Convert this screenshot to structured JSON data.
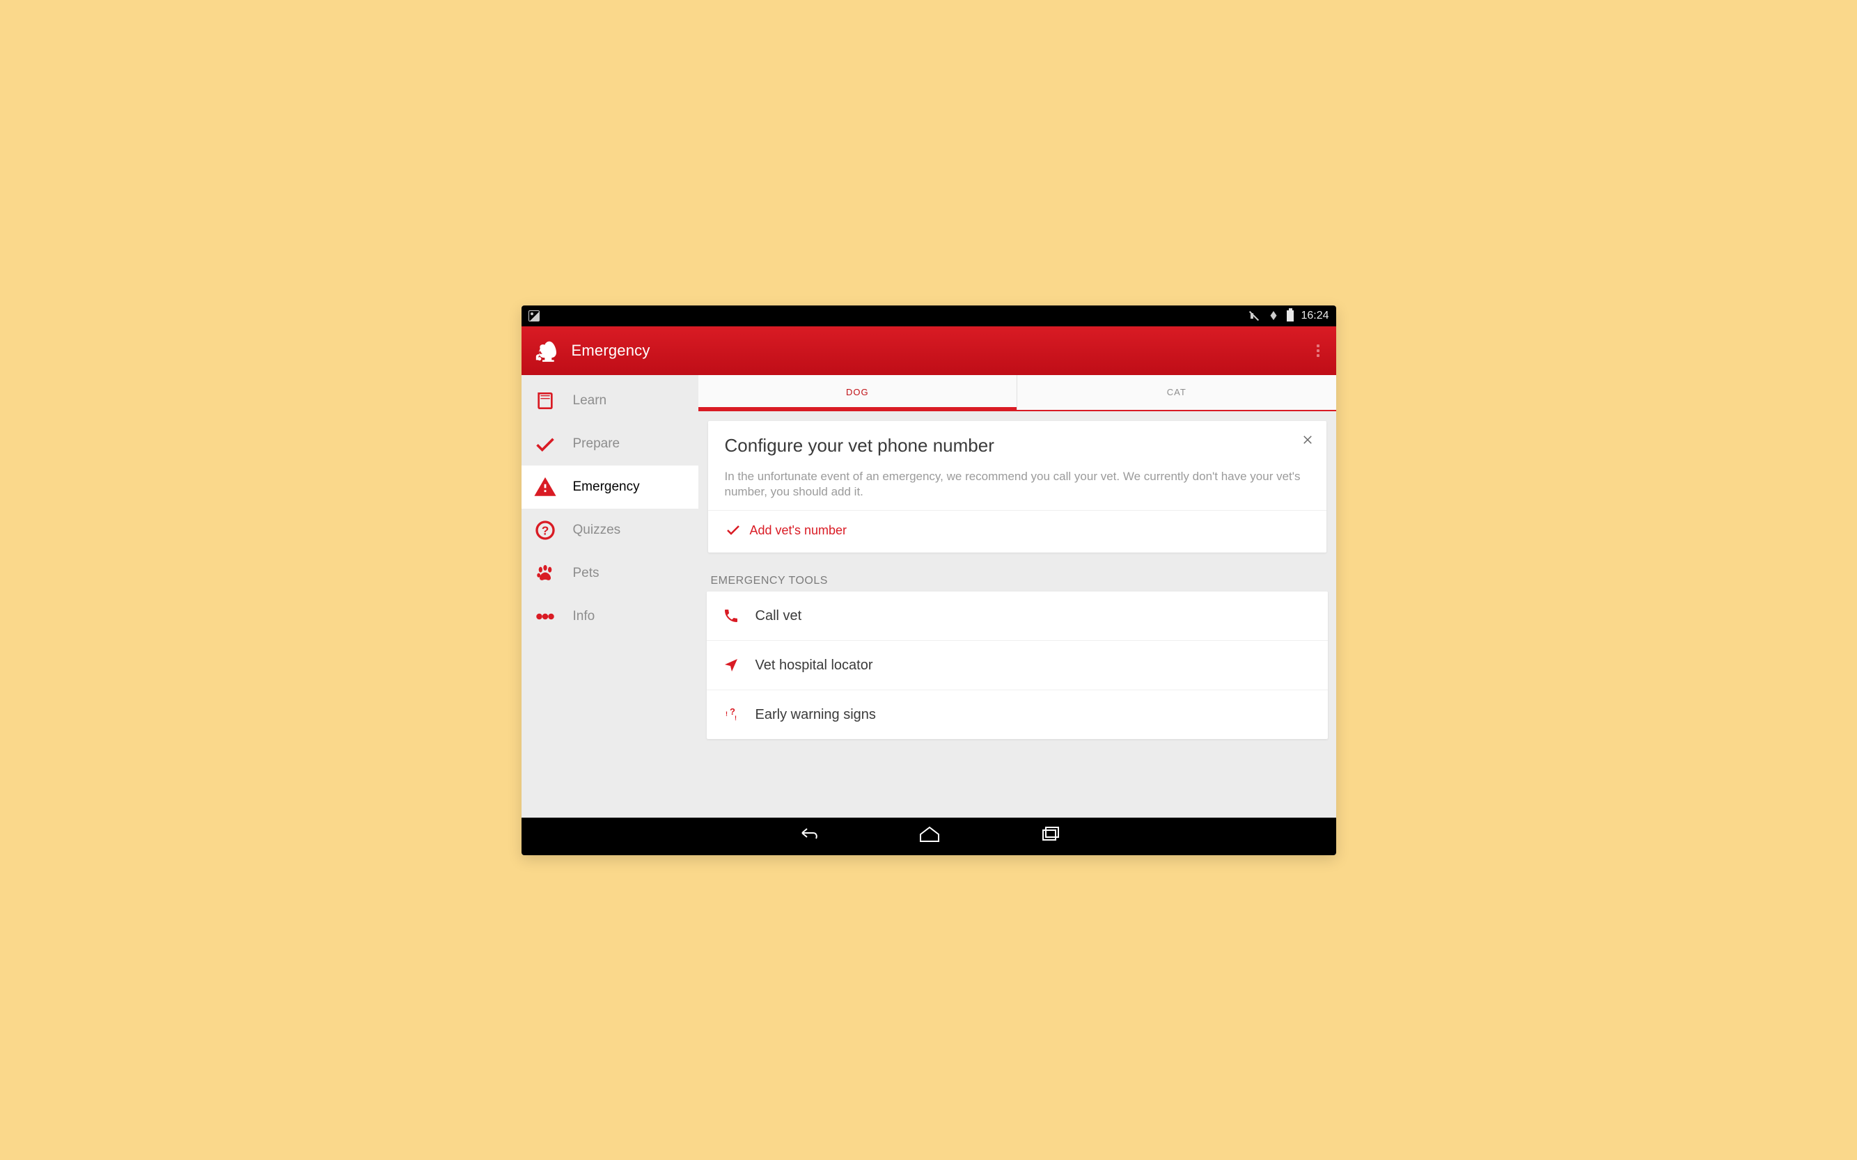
{
  "statusbar": {
    "time": "16:24"
  },
  "actionbar": {
    "title": "Emergency"
  },
  "sidebar": {
    "items": [
      {
        "label": "Learn",
        "icon": "book",
        "active": false
      },
      {
        "label": "Prepare",
        "icon": "check",
        "active": false
      },
      {
        "label": "Emergency",
        "icon": "warning",
        "active": true
      },
      {
        "label": "Quizzes",
        "icon": "question",
        "active": false
      },
      {
        "label": "Pets",
        "icon": "paw",
        "active": false
      },
      {
        "label": "Info",
        "icon": "dots",
        "active": false
      }
    ]
  },
  "tabs": {
    "items": [
      {
        "label": "DOG",
        "active": true
      },
      {
        "label": "CAT",
        "active": false
      }
    ]
  },
  "panel": {
    "title": "Configure your vet phone number",
    "body": "In the unfortunate event of an emergency, we recommend you call your vet. We currently don't have your vet's number, you should add it.",
    "add_label": "Add vet's number"
  },
  "tools": {
    "heading": "EMERGENCY TOOLS",
    "items": [
      {
        "icon": "phone",
        "label": "Call vet"
      },
      {
        "icon": "location",
        "label": "Vet hospital locator"
      },
      {
        "icon": "warning-small",
        "label": "Early warning signs"
      }
    ]
  }
}
